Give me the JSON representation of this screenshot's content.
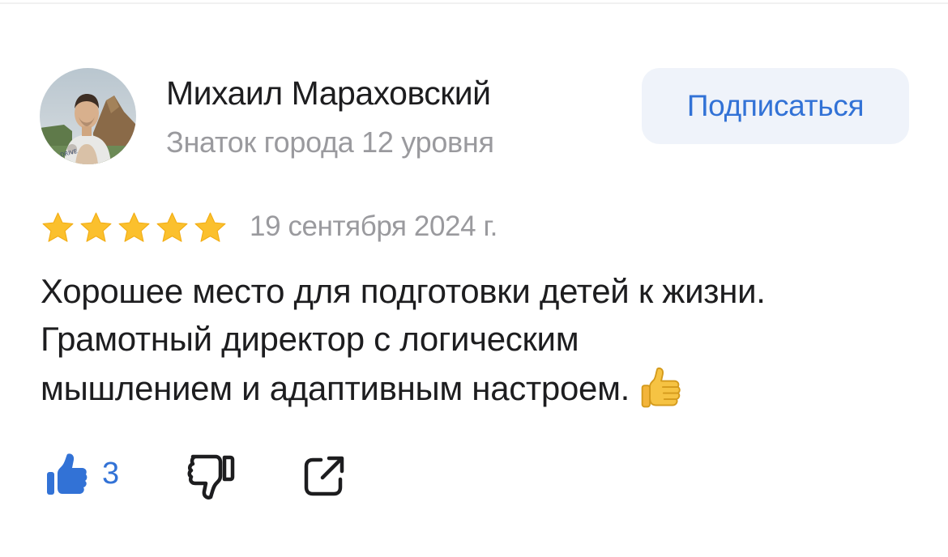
{
  "author": {
    "name": "Михаил Мараховский",
    "level": "Знаток города 12 уровня",
    "avatar_icon": "person-avatar"
  },
  "subscribe_label": "Подписаться",
  "review": {
    "rating": 5,
    "rating_max": 5,
    "date": "19 сентября 2024 г.",
    "text_lines": [
      "Хорошее место для подготовки детей к жизни.",
      "Грамотный директор с логическим",
      "мышлением и адаптивным настроем."
    ],
    "emoji": "thumbs-up-emoji"
  },
  "actions": {
    "like_count": "3",
    "like_icon": "thumbs-up-icon",
    "dislike_icon": "thumbs-down-icon",
    "share_icon": "share-icon"
  },
  "colors": {
    "accent": "#3272d6",
    "button_bg": "#eff3fa",
    "star": "#fbc02d",
    "muted_text": "#9a9a9e",
    "text": "#1d1d1f"
  }
}
